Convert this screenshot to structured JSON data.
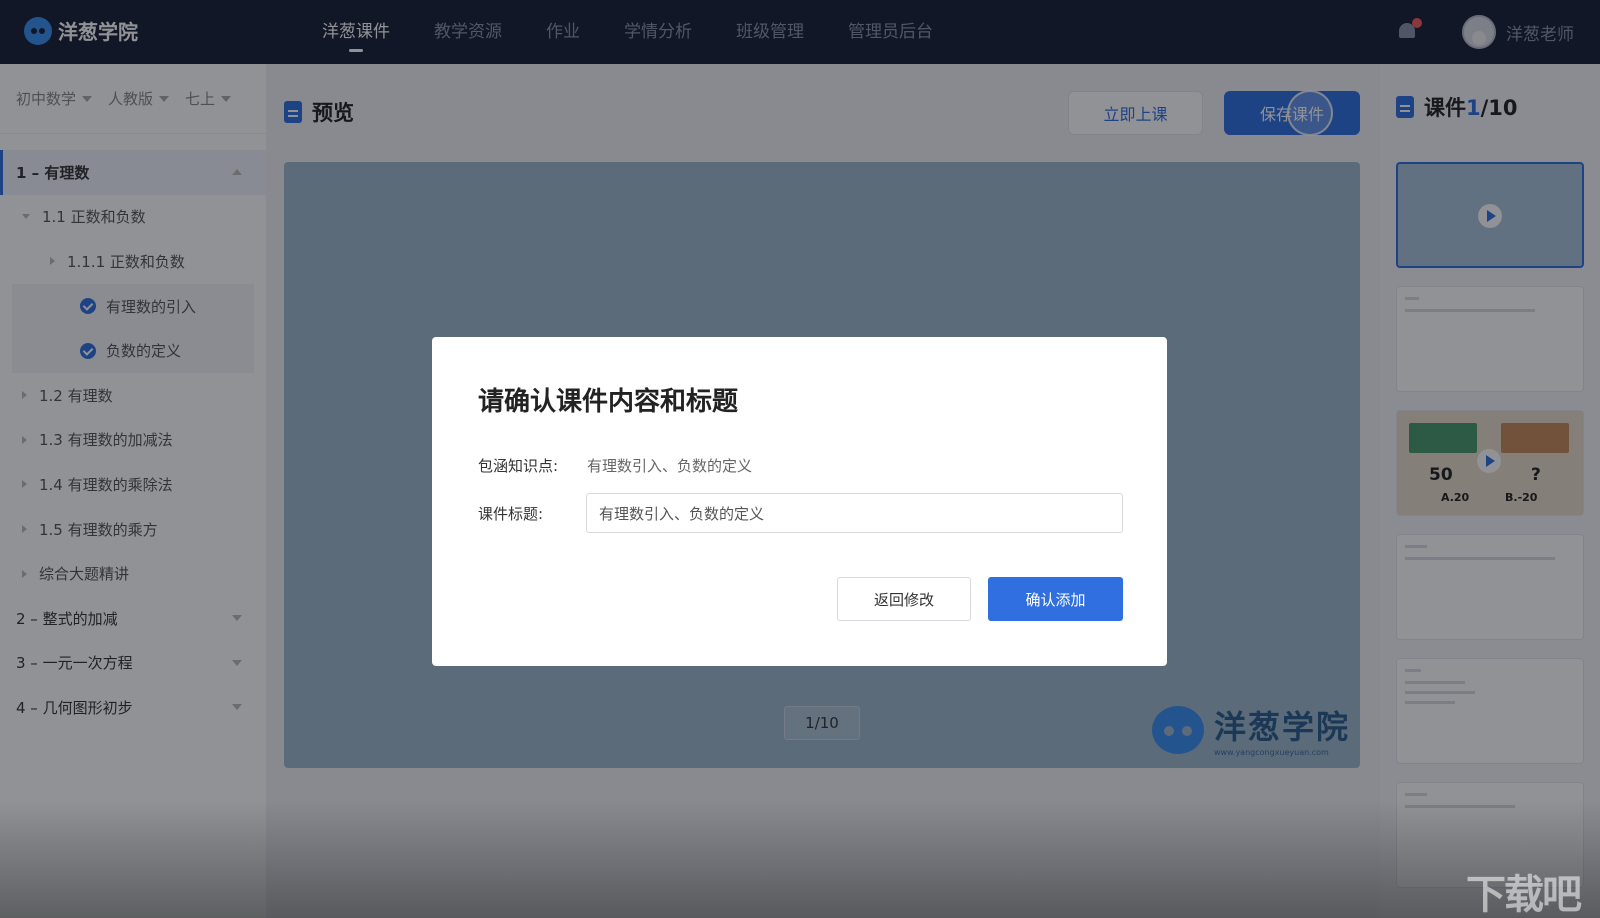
{
  "brand": {
    "name": "洋葱学院"
  },
  "nav": {
    "items": [
      {
        "label": "洋葱课件",
        "active": true
      },
      {
        "label": "教学资源",
        "active": false
      },
      {
        "label": "作业",
        "active": false
      },
      {
        "label": "学情分析",
        "active": false
      },
      {
        "label": "班级管理",
        "active": false
      },
      {
        "label": "管理员后台",
        "active": false
      }
    ]
  },
  "user": {
    "name": "洋葱老师"
  },
  "filters": [
    {
      "label": "初中数学"
    },
    {
      "label": "人教版"
    },
    {
      "label": "七上"
    }
  ],
  "tree": [
    {
      "label": "1 – 有理数"
    },
    {
      "label": "1.1 正数和负数"
    },
    {
      "label": "1.1.1 正数和负数"
    },
    {
      "label": "有理数的引入"
    },
    {
      "label": "负数的定义"
    },
    {
      "label": "1.2 有理数"
    },
    {
      "label": "1.3 有理数的加减法"
    },
    {
      "label": "1.4 有理数的乘除法"
    },
    {
      "label": "1.5 有理数的乘方"
    },
    {
      "label": "综合大题精讲"
    },
    {
      "label": "2 – 整式的加减"
    },
    {
      "label": "3 – 一元一次方程"
    },
    {
      "label": "4 – 几何图形初步"
    }
  ],
  "preview": {
    "title": "预览",
    "start_button": "立即上课",
    "save_button": "保存课件",
    "page_indicator": "1/10",
    "watermark_name": "洋葱学院",
    "watermark_url": "www.yangcongxueyuan.com"
  },
  "courseware": {
    "label": "课件",
    "current": "1",
    "total": "/10",
    "thumb3": {
      "left_value": "50",
      "right_value": "?",
      "option_a": "A.20",
      "option_b": "B.-20"
    }
  },
  "dialog": {
    "title": "请确认课件内容和标题",
    "knowledge_label": "包涵知识点:",
    "knowledge_value": "有理数引入、负数的定义",
    "title_label": "课件标题:",
    "title_input_value": "有理数引入、负数的定义",
    "back_button": "返回修改",
    "confirm_button": "确认添加"
  },
  "site_watermark": "下载吧",
  "colors": {
    "primary": "#2f6fe0",
    "topbar": "#171f33",
    "stage": "#9fb8cc"
  }
}
